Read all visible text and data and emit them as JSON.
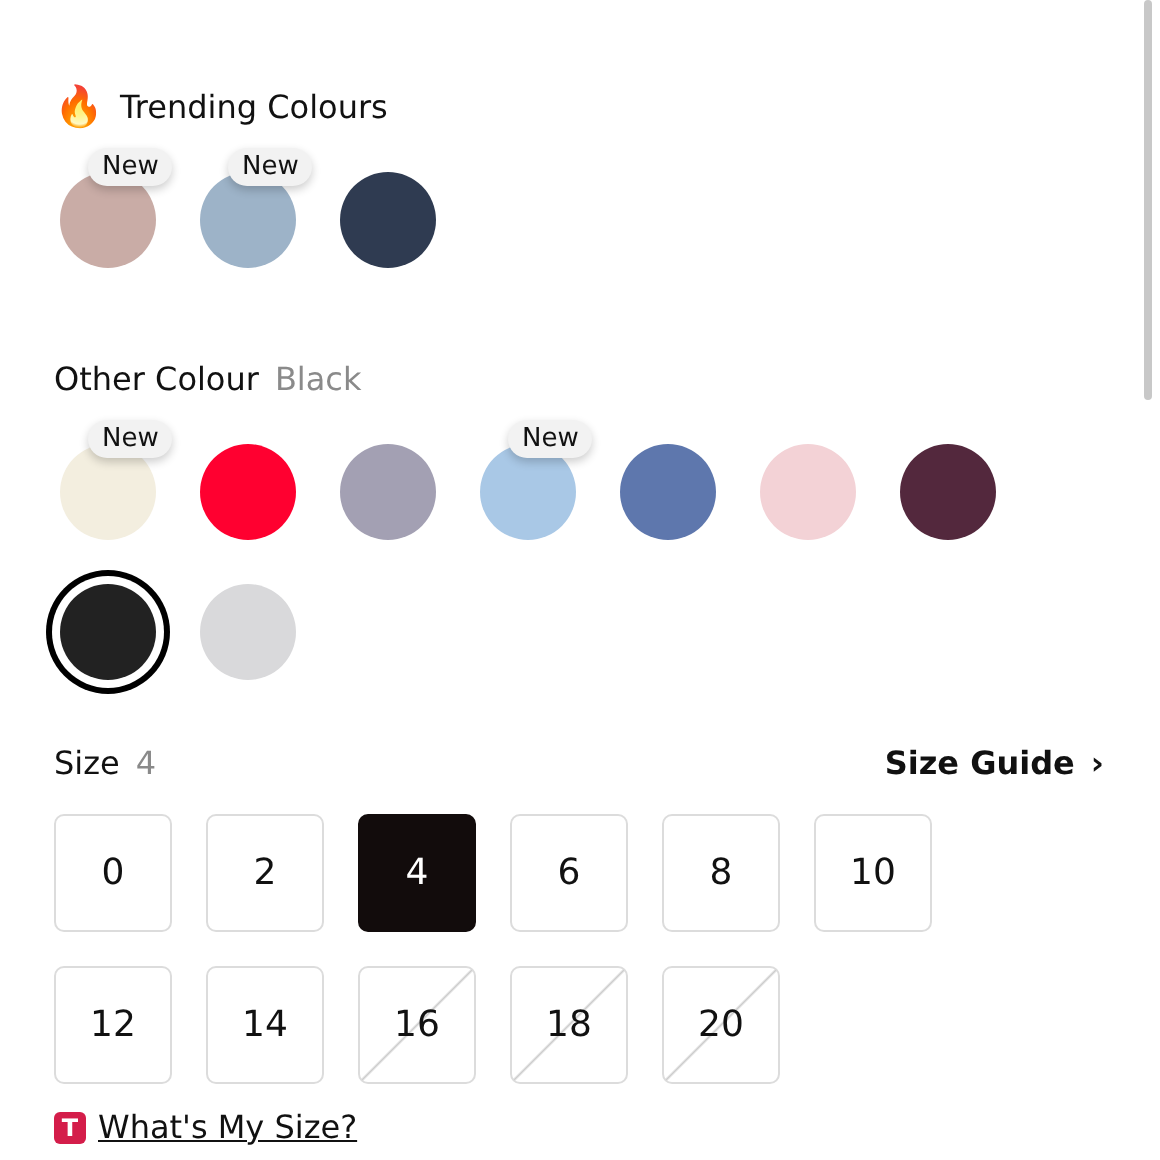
{
  "trending": {
    "emoji": "🔥",
    "title": "Trending Colours",
    "swatches": [
      {
        "color": "#c9aca6",
        "new_badge": "New",
        "selected": false
      },
      {
        "color": "#9db3c8",
        "new_badge": "New",
        "selected": false
      },
      {
        "color": "#2f3b51",
        "selected": false
      }
    ]
  },
  "other": {
    "title": "Other Colour",
    "value": "Black",
    "swatches": [
      {
        "color": "#f3eedf",
        "new_badge": "New",
        "selected": false
      },
      {
        "color": "#ff0030",
        "selected": false
      },
      {
        "color": "#a3a0b3",
        "selected": false
      },
      {
        "color": "#a9c8e6",
        "new_badge": "New",
        "selected": false
      },
      {
        "color": "#5e77ad",
        "selected": false
      },
      {
        "color": "#f3d2d6",
        "selected": false
      },
      {
        "color": "#53283d",
        "selected": false
      },
      {
        "color": "#222222",
        "selected": true
      },
      {
        "color": "#d9d9db",
        "selected": false
      }
    ]
  },
  "size": {
    "title": "Size",
    "value": "4",
    "guide": "Size Guide",
    "guide_arrow": "›",
    "options": [
      {
        "label": "0",
        "selected": false,
        "available": true
      },
      {
        "label": "2",
        "selected": false,
        "available": true
      },
      {
        "label": "4",
        "selected": true,
        "available": true
      },
      {
        "label": "6",
        "selected": false,
        "available": true
      },
      {
        "label": "8",
        "selected": false,
        "available": true
      },
      {
        "label": "10",
        "selected": false,
        "available": true
      },
      {
        "label": "12",
        "selected": false,
        "available": true
      },
      {
        "label": "14",
        "selected": false,
        "available": true
      },
      {
        "label": "16",
        "selected": false,
        "available": false
      },
      {
        "label": "18",
        "selected": false,
        "available": false
      },
      {
        "label": "20",
        "selected": false,
        "available": false
      }
    ]
  },
  "fit_link": {
    "badge": "T",
    "label": "What's My Size?"
  }
}
